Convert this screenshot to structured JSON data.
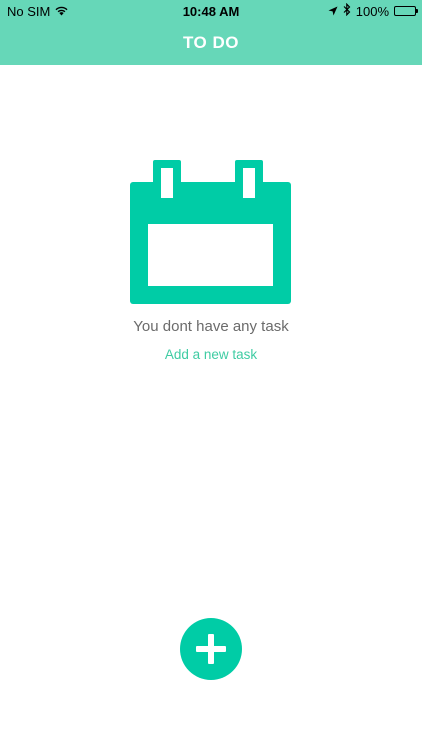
{
  "status_bar": {
    "carrier": "No SIM",
    "time": "10:48 AM",
    "battery": "100%"
  },
  "header": {
    "title": "TO DO"
  },
  "empty_state": {
    "message": "You dont have any task",
    "link_label": "Add a new task"
  },
  "colors": {
    "header_bg": "#66d7b8",
    "accent": "#00cca6",
    "link": "#3fcca3"
  }
}
